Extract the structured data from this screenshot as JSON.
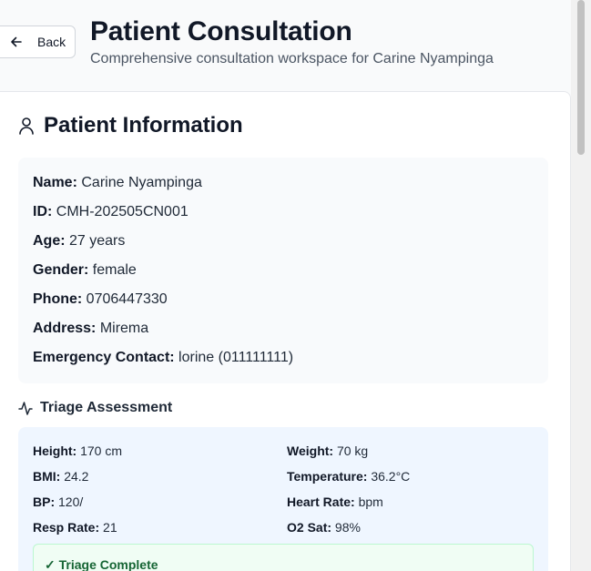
{
  "header": {
    "back_label": "Back",
    "title": "Patient Consultation",
    "subtitle": "Comprehensive consultation workspace for Carine Nyampinga"
  },
  "patient_info": {
    "section_title": "Patient Information",
    "fields": [
      {
        "label": "Name:",
        "value": "Carine Nyampinga"
      },
      {
        "label": "ID:",
        "value": "CMH-202505CN001"
      },
      {
        "label": "Age:",
        "value": "27 years"
      },
      {
        "label": "Gender:",
        "value": "female"
      },
      {
        "label": "Phone:",
        "value": "0706447330"
      },
      {
        "label": "Address:",
        "value": "Mirema"
      },
      {
        "label": "Emergency Contact:",
        "value": "lorine (011111111)"
      }
    ]
  },
  "triage": {
    "section_title": "Triage Assessment",
    "fields": [
      {
        "label": "Height:",
        "value": "170 cm"
      },
      {
        "label": "Weight:",
        "value": "70 kg"
      },
      {
        "label": "BMI:",
        "value": "24.2"
      },
      {
        "label": "Temperature:",
        "value": "36.2°C"
      },
      {
        "label": "BP:",
        "value": "120/"
      },
      {
        "label": "Heart Rate:",
        "value": "bpm"
      },
      {
        "label": "Resp Rate:",
        "value": "21"
      },
      {
        "label": "O2 Sat:",
        "value": "98%"
      }
    ],
    "status": "✓ Triage Complete"
  },
  "colors": {
    "info_bg": "#f8fafc",
    "triage_bg": "#eff6ff",
    "complete_bg": "#f0fdf4",
    "complete_text": "#166534"
  }
}
